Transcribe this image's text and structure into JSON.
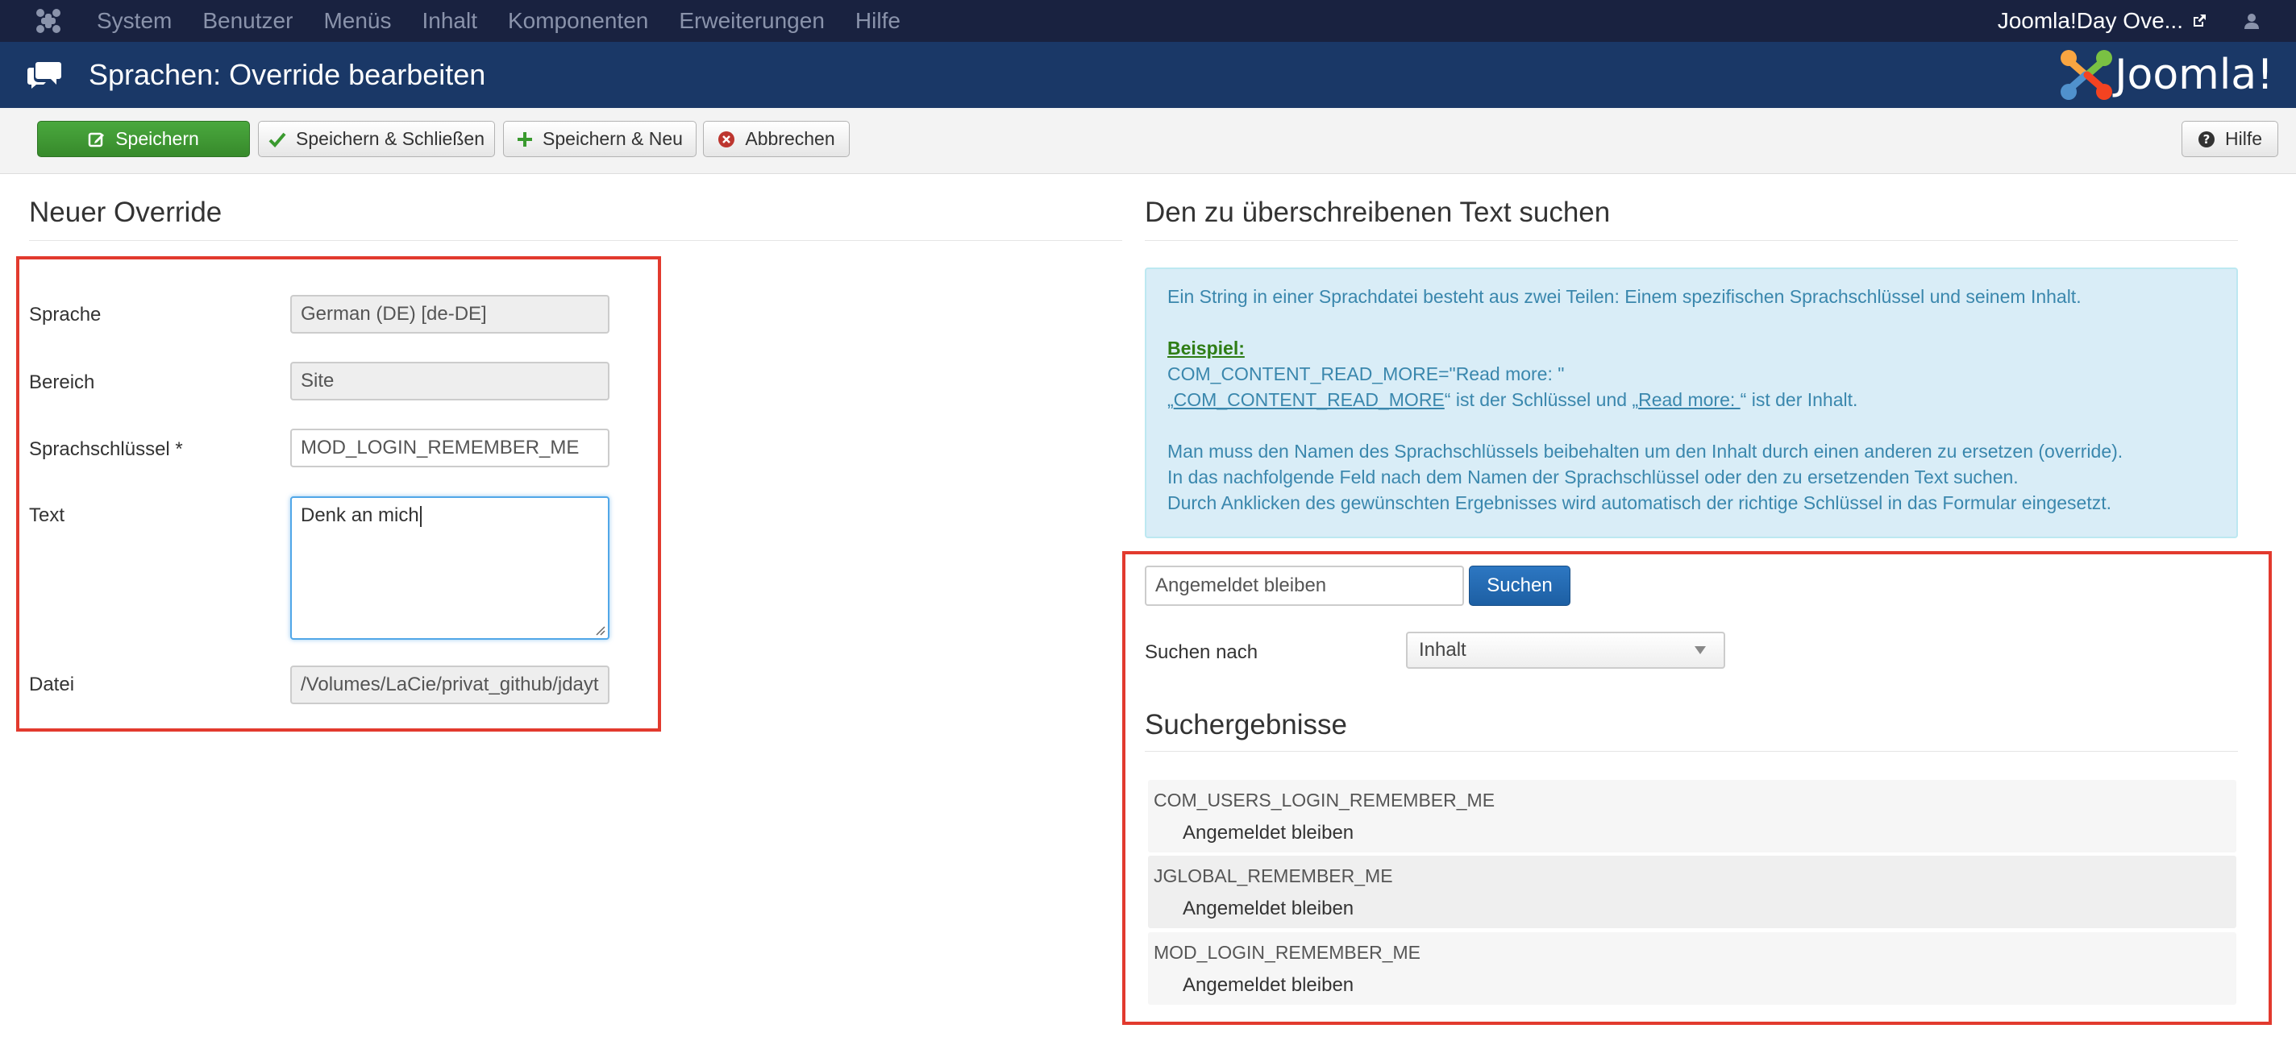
{
  "topnav": {
    "menu": [
      "System",
      "Benutzer",
      "Menüs",
      "Inhalt",
      "Komponenten",
      "Erweiterungen",
      "Hilfe"
    ],
    "site_link": "Joomla!Day Ove..."
  },
  "header": {
    "title": "Sprachen: Override bearbeiten",
    "brand": "Joomla!"
  },
  "toolbar": {
    "save": "Speichern",
    "save_close": "Speichern & Schließen",
    "save_new": "Speichern & Neu",
    "cancel": "Abbrechen",
    "help": "Hilfe"
  },
  "form": {
    "heading": "Neuer Override",
    "language_label": "Sprache",
    "language_value": "German (DE) [de-DE]",
    "area_label": "Bereich",
    "area_value": "Site",
    "key_label": "Sprachschlüssel *",
    "key_value": "MOD_LOGIN_REMEMBER_ME",
    "text_label": "Text",
    "text_value": "Denk an mich",
    "file_label": "Datei",
    "file_value": "/Volumes/LaCie/privat_github/jdayt"
  },
  "search": {
    "heading": "Den zu überschreibenen Text suchen",
    "info": {
      "line1": "Ein String in einer Sprachdatei besteht aus zwei Teilen: Einem spezifischen Sprachschlüssel und seinem Inhalt.",
      "example_label": "Beispiel:",
      "example_line": "COM_CONTENT_READ_MORE=\"Read more: \"",
      "ex_q1": "„",
      "ex_key": "COM_CONTENT_READ_MORE",
      "ex_mid": "“ ist der Schlüssel und „",
      "ex_val": "Read more: ",
      "ex_end": "“ ist der Inhalt.",
      "line2": "Man muss den Namen des Sprachschlüssels beibehalten um den Inhalt durch einen anderen zu ersetzen (override).",
      "line3": "In das nachfolgende Feld nach dem Namen der Sprachschlüssel oder den zu ersetzenden Text suchen.",
      "line4": "Durch Anklicken des gewünschten Ergebnisses wird automatisch der richtige Schlüssel in das Formular eingesetzt."
    },
    "query": "Angemeldet bleiben",
    "button": "Suchen",
    "search_for_label": "Suchen nach",
    "search_for_value": "Inhalt",
    "results_heading": "Suchergebnisse",
    "results": [
      {
        "key": "COM_USERS_LOGIN_REMEMBER_ME",
        "value": "Angemeldet bleiben"
      },
      {
        "key": "JGLOBAL_REMEMBER_ME",
        "value": "Angemeldet bleiben"
      },
      {
        "key": "MOD_LOGIN_REMEMBER_ME",
        "value": "Angemeldet bleiben"
      }
    ]
  },
  "colors": {
    "topnav_bg": "#192240",
    "header_bg": "#1a3867",
    "save_green": "#3f9a33",
    "highlight_red": "#e23a2e",
    "info_bg": "#d9edf7",
    "search_blue": "#2a6db5"
  }
}
